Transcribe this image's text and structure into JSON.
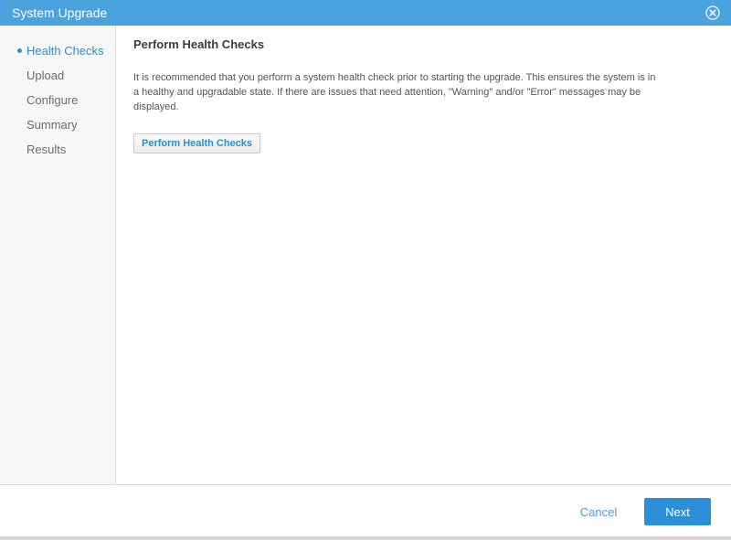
{
  "window": {
    "title": "System Upgrade",
    "close_icon": "close-circle-icon"
  },
  "colors": {
    "titlebar": "#4aa3df",
    "accent": "#2a8fd7",
    "sidebar_bg": "#f7f7f7"
  },
  "sidebar": {
    "steps": [
      {
        "label": "Health Checks",
        "active": true
      },
      {
        "label": "Upload",
        "active": false
      },
      {
        "label": "Configure",
        "active": false
      },
      {
        "label": "Summary",
        "active": false
      },
      {
        "label": "Results",
        "active": false
      }
    ]
  },
  "main": {
    "heading": "Perform Health Checks",
    "description": "It is recommended that you perform a system health check prior to starting the upgrade. This ensures the system is in a healthy and upgradable state. If there are issues that need attention, \"Warning\" and/or \"Error\" messages may be displayed.",
    "action_label": "Perform Health Checks"
  },
  "footer": {
    "cancel_label": "Cancel",
    "next_label": "Next"
  }
}
